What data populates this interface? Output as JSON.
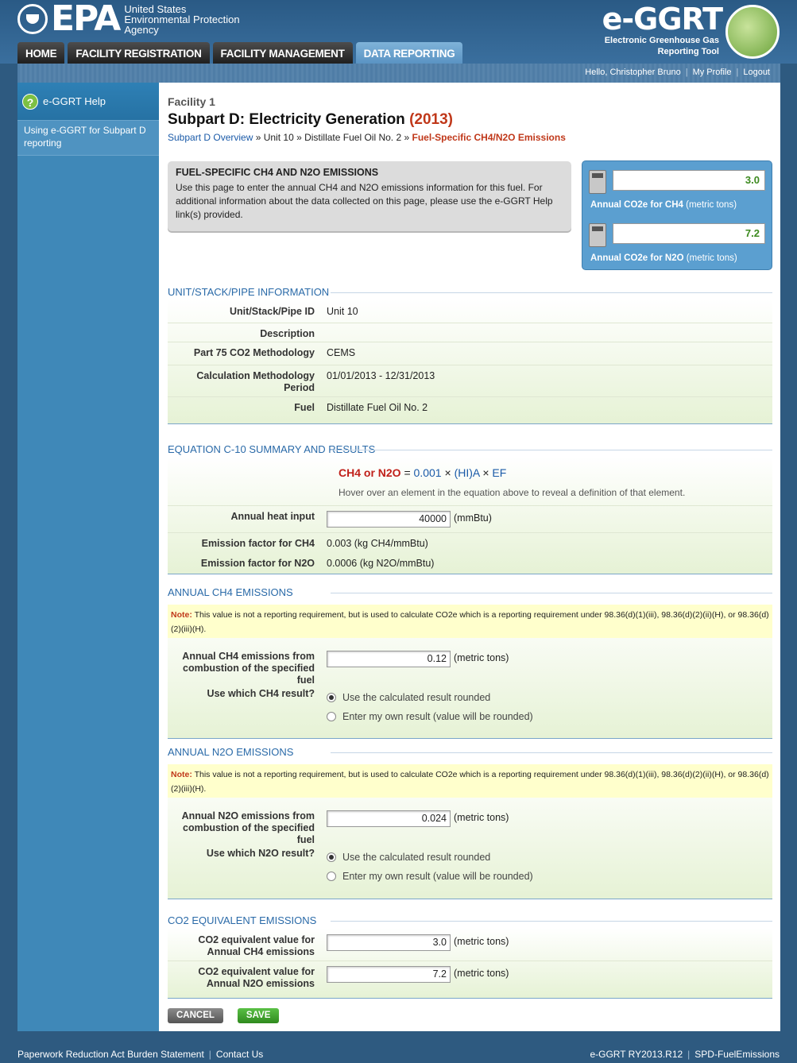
{
  "header": {
    "agency_line1": "United States",
    "agency_line2": "Environmental Protection",
    "agency_line3": "Agency",
    "logo_text": "EPA",
    "brand_title": "e-GGRT",
    "brand_sub1": "Electronic Greenhouse Gas",
    "brand_sub2": "Reporting Tool",
    "tabs": [
      "HOME",
      "FACILITY REGISTRATION",
      "FACILITY MANAGEMENT",
      "DATA REPORTING"
    ],
    "active_tab": "DATA REPORTING"
  },
  "userbar": {
    "greeting": "Hello, Christopher Bruno",
    "profile": "My Profile",
    "logout": "Logout"
  },
  "sidebar": {
    "help_label": "e-GGRT Help",
    "help_icon": "question-icon",
    "link_line1": "Using e-GGRT for Subpart D",
    "link_line2": "reporting"
  },
  "page": {
    "facility": "Facility 1",
    "title": "Subpart D: Electricity Generation",
    "year": "(2013)",
    "breadcrumb": {
      "overview": "Subpart D Overview",
      "unit": "Unit 10",
      "fuel": "Distillate Fuel Oil No. 2",
      "current": "Fuel-Specific CH4/N2O Emissions"
    }
  },
  "intro": {
    "heading": "FUEL-SPECIFIC CH4 AND N2O EMISSIONS",
    "text": "Use this page to enter the annual CH4 and N2O emissions information for this fuel. For additional information about the data collected on this page, please use the e-GGRT Help link(s) provided."
  },
  "calculators": [
    {
      "value": "3.0",
      "label": "Annual CO2e for CH4",
      "unit": "(metric tons)"
    },
    {
      "value": "7.2",
      "label": "Annual CO2e for N2O",
      "unit": "(metric tons)"
    }
  ],
  "unit_info": {
    "heading": "UNIT/STACK/PIPE INFORMATION",
    "rows": [
      {
        "label": "Unit/Stack/Pipe ID",
        "value": "Unit 10"
      },
      {
        "label": "Description",
        "value": ""
      },
      {
        "label": "Part 75 CO2 Methodology",
        "value": "CEMS"
      },
      {
        "label": "Calculation Methodology Period",
        "value": "01/01/2013 - 12/31/2013"
      },
      {
        "label": "Fuel",
        "value": "Distillate Fuel Oil No. 2"
      }
    ]
  },
  "equation": {
    "heading": "EQUATION C-10 SUMMARY AND RESULTS",
    "lhs": "CH4 or N2O",
    "eq": "=",
    "coef": "0.001",
    "times": "×",
    "hi": "(HI)A",
    "ef": "EF",
    "hint": "Hover over an element in the equation above to reveal a definition of that element.",
    "heat_input_label": "Annual heat input",
    "heat_input_value": "40000",
    "heat_input_unit": "(mmBtu)",
    "ef_ch4_label": "Emission factor for CH4",
    "ef_ch4_value": "0.003 (kg CH4/mmBtu)",
    "ef_n2o_label": "Emission factor for N2O",
    "ef_n2o_value": "0.0006 (kg N2O/mmBtu)"
  },
  "ch4": {
    "heading": "ANNUAL CH4 EMISSIONS",
    "note_label": "Note:",
    "note_text": "This value is not a reporting requirement, but is used to calculate CO2e which is a reporting requirement under 98.36(d)(1)(iii), 98.36(d)(2)(ii)(H), or 98.36(d)(2)(iii)(H).",
    "emis_label": "Annual CH4 emissions from combustion of the specified fuel",
    "emis_value": "0.12",
    "emis_unit": "(metric tons)",
    "which_label": "Use which CH4 result?",
    "option1": "Use the calculated result rounded",
    "option2": "Enter my own result (value will be rounded)"
  },
  "n2o": {
    "heading": "ANNUAL N2O EMISSIONS",
    "note_label": "Note:",
    "note_text": "This value is not a reporting requirement, but is used to calculate CO2e which is a reporting requirement under 98.36(d)(1)(iii), 98.36(d)(2)(ii)(H), or 98.36(d)(2)(iii)(H).",
    "emis_label": "Annual N2O emissions from combustion of the specified fuel",
    "emis_value": "0.024",
    "emis_unit": "(metric tons)",
    "which_label": "Use which N2O result?",
    "option1": "Use the calculated result rounded",
    "option2": "Enter my own result (value will be rounded)"
  },
  "co2e": {
    "heading": "CO2 EQUIVALENT EMISSIONS",
    "ch4_label": "CO2 equivalent value for Annual CH4 emissions",
    "ch4_value": "3.0",
    "n2o_label": "CO2 equivalent value for Annual N2O emissions",
    "n2o_value": "7.2",
    "unit": "(metric tons)"
  },
  "buttons": {
    "cancel": "CANCEL",
    "save": "SAVE"
  },
  "footer": {
    "paperwork": "Paperwork Reduction Act Burden Statement",
    "contact": "Contact Us",
    "version": "e-GGRT RY2013.R12",
    "page_id": "SPD-FuelEmissions"
  }
}
